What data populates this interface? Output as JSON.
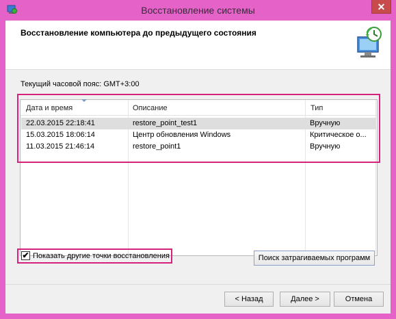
{
  "window": {
    "title": "Восстановление системы",
    "close_label": "✕"
  },
  "header": {
    "title": "Восстановление компьютера до предыдущего состояния"
  },
  "timezone_label": "Текущий часовой пояс: GMT+3:00",
  "table": {
    "columns": [
      "Дата и время",
      "Описание",
      "Тип"
    ],
    "rows": [
      {
        "date": "22.03.2015 22:18:41",
        "description": "restore_point_test1",
        "type": "Вручную"
      },
      {
        "date": "15.03.2015 18:06:14",
        "description": "Центр обновления Windows",
        "type": "Критическое о..."
      },
      {
        "date": "11.03.2015 21:46:14",
        "description": "restore_point1",
        "type": "Вручную"
      }
    ]
  },
  "options": {
    "show_more_label": "Показать другие точки восстановления",
    "show_more_checked": true,
    "check_glyph": "✔"
  },
  "buttons": {
    "scan_label": "Поиск затрагиваемых программ",
    "back_label": "< Назад",
    "next_label": "Далее >",
    "cancel_label": "Отмена"
  },
  "colors": {
    "frame": "#e563c9",
    "highlight": "#d6217d",
    "selected_row": "#dedede"
  }
}
